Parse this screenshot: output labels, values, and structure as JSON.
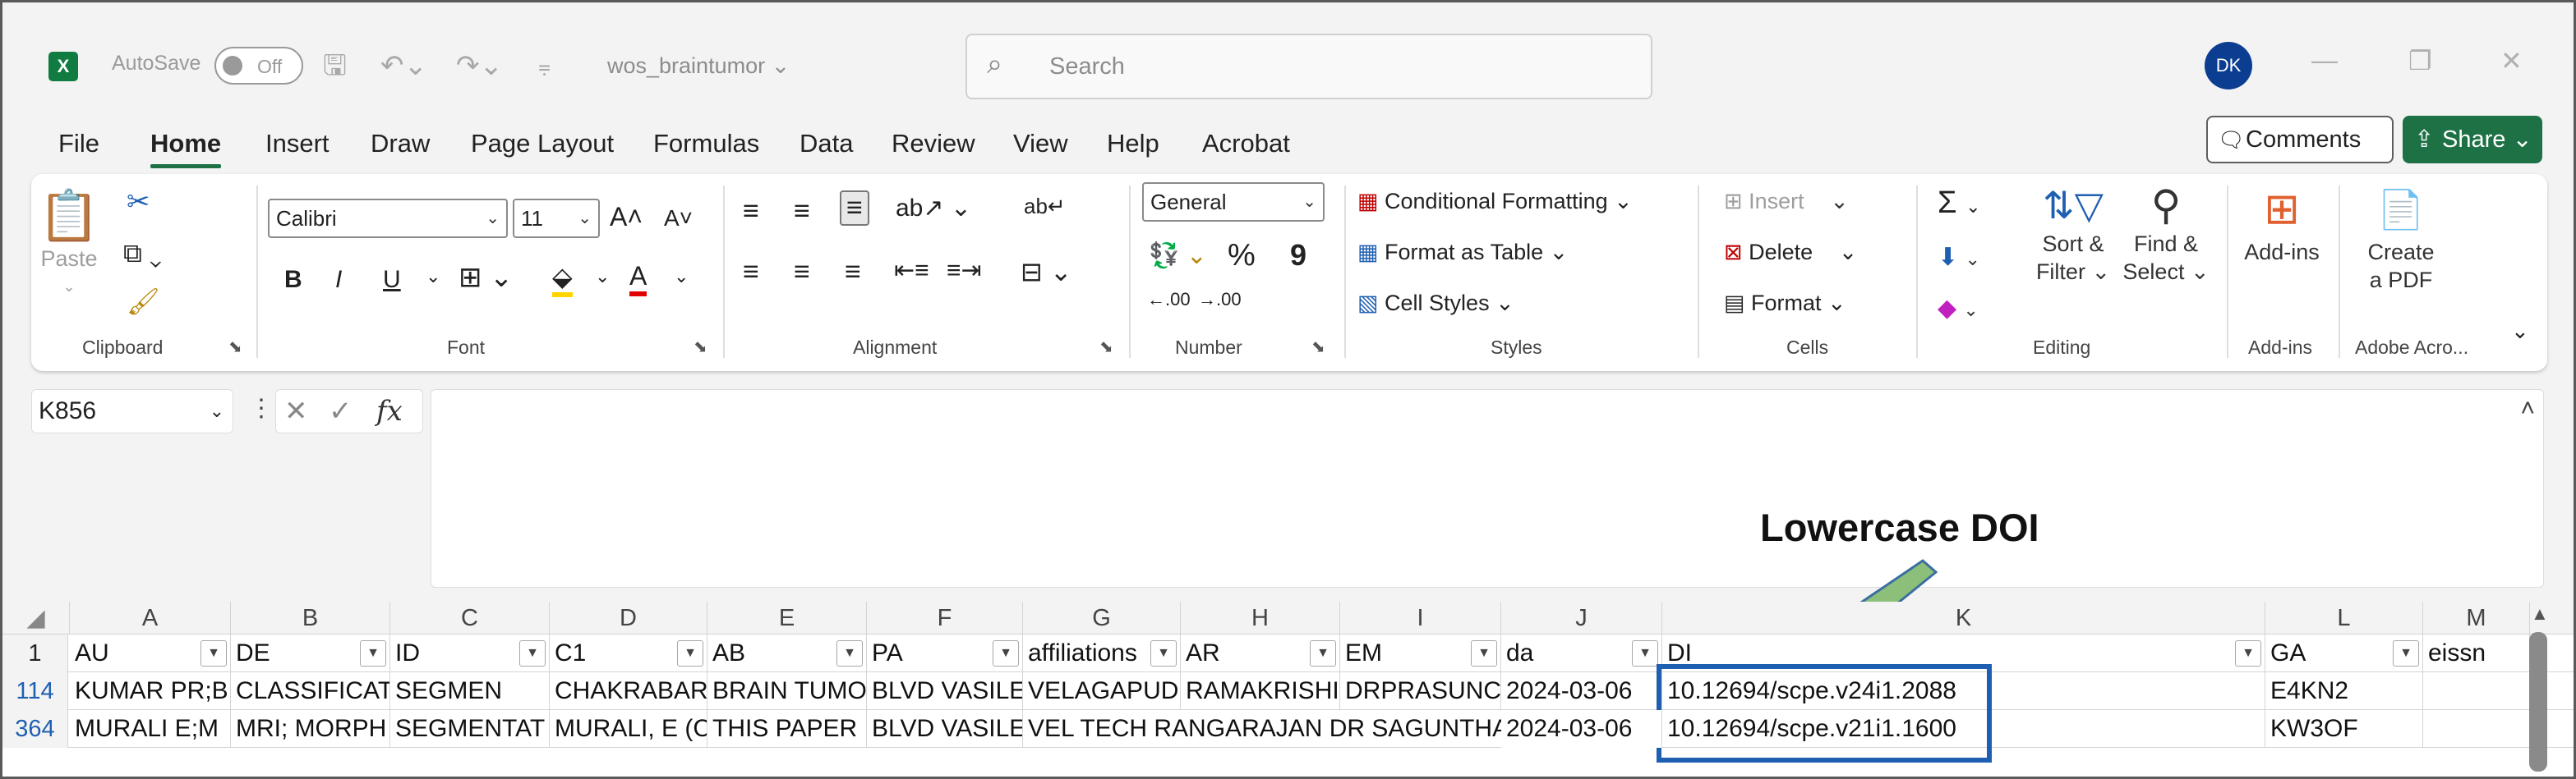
{
  "titlebar": {
    "app_icon": "X",
    "autosave_label": "AutoSave",
    "autosave_state": "Off",
    "filename": "wos_braintumor",
    "search_placeholder": "Search",
    "user_initials": "DK"
  },
  "menu": {
    "tabs": [
      "File",
      "Home",
      "Insert",
      "Draw",
      "Page Layout",
      "Formulas",
      "Data",
      "Review",
      "View",
      "Help",
      "Acrobat"
    ],
    "active_tab": "Home",
    "comments_label": "Comments",
    "share_label": "Share"
  },
  "ribbon": {
    "clipboard": {
      "label": "Clipboard",
      "paste": "Paste"
    },
    "font": {
      "label": "Font",
      "family": "Calibri",
      "size": "11",
      "bold": "B",
      "italic": "I",
      "underline": "U"
    },
    "alignment": {
      "label": "Alignment"
    },
    "number": {
      "label": "Number",
      "format": "General",
      "percent": "%",
      "comma": "9",
      "inc_decimal": ".00",
      "dec_decimal": ".00"
    },
    "styles": {
      "label": "Styles",
      "conditional": "Conditional Formatting",
      "format_table": "Format as Table",
      "cell_styles": "Cell Styles"
    },
    "cells": {
      "label": "Cells",
      "insert": "Insert",
      "delete": "Delete",
      "format": "Format"
    },
    "editing": {
      "label": "Editing",
      "sort_filter_1": "Sort &",
      "sort_filter_2": "Filter",
      "find_select_1": "Find &",
      "find_select_2": "Select"
    },
    "addins": {
      "label": "Add-ins",
      "button": "Add-ins"
    },
    "adobe": {
      "label": "Adobe Acro...",
      "create_1": "Create",
      "create_2": "a PDF"
    }
  },
  "formula_bar": {
    "name_box": "K856",
    "fx": "fx",
    "value": ""
  },
  "annotation": {
    "text": "Lowercase DOI",
    "arrow_color": "#8cc07a",
    "box_color": "#1f5fb2"
  },
  "sheet": {
    "columns": [
      "A",
      "B",
      "C",
      "D",
      "E",
      "F",
      "G",
      "H",
      "I",
      "J",
      "K",
      "L",
      "M"
    ],
    "header_row_num": "1",
    "headers": [
      "AU",
      "DE",
      "ID",
      "C1",
      "AB",
      "PA",
      "affiliations",
      "AR",
      "EM",
      "da",
      "DI",
      "GA",
      "eissn"
    ],
    "rows": [
      {
        "num": "114",
        "cells": [
          "KUMAR PR;B",
          "CLASSIFICATION;",
          "SEGMEN",
          "CHAKRABART",
          "BRAIN TUMO",
          "BLVD VASILE",
          "VELAGAPUDI",
          "RAMAKRISHI",
          "DRPRASUNCI",
          "2024-03-06",
          "10.12694/scpe.v24i1.2088",
          "E4KN2",
          ""
        ]
      },
      {
        "num": "364",
        "cells": [
          "MURALI E;M",
          "MRI; MORPH",
          "SEGMENTAT",
          "MURALI, E (C",
          "THIS PAPER I",
          "BLVD VASILE",
          "VEL TECH RANGARAJAN DR SAGUNTHA",
          "",
          "",
          "2024-03-06",
          "10.12694/scpe.v21i1.1600",
          "KW3OF",
          ""
        ]
      }
    ]
  }
}
